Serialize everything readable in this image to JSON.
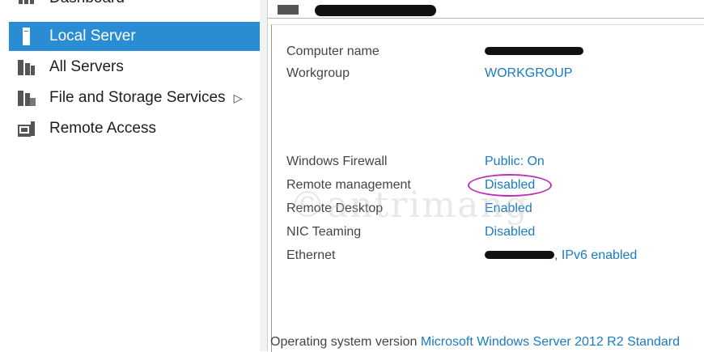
{
  "sidebar": {
    "items": [
      {
        "label": "Dashboard",
        "icon": "dashboard-icon",
        "selected": false
      },
      {
        "label": "Local Server",
        "icon": "local-server-icon",
        "selected": true
      },
      {
        "label": "All Servers",
        "icon": "all-servers-icon",
        "selected": false
      },
      {
        "label": "File and Storage Services",
        "icon": "file-storage-icon",
        "selected": false,
        "arrow": "▷"
      },
      {
        "label": "Remote Access",
        "icon": "remote-access-icon",
        "selected": false
      }
    ]
  },
  "properties": {
    "computer_name": {
      "label": "Computer name"
    },
    "workgroup": {
      "label": "Workgroup",
      "value": "WORKGROUP"
    },
    "firewall": {
      "label": "Windows Firewall",
      "value": "Public: On"
    },
    "remote_management": {
      "label": "Remote management",
      "value": "Disabled"
    },
    "remote_desktop": {
      "label": "Remote Desktop",
      "value": "Enabled"
    },
    "nic_teaming": {
      "label": "NIC Teaming",
      "value": "Disabled"
    },
    "ethernet": {
      "label": "Ethernet",
      "value": ", IPv6 enabled"
    },
    "os_version": {
      "label": "Operating system version",
      "value": "Microsoft Windows Server 2012 R2 Standard"
    }
  },
  "colors": {
    "accent": "#2a8dd4",
    "link": "#1a7bc4",
    "highlight_circle": "#b833b8"
  }
}
